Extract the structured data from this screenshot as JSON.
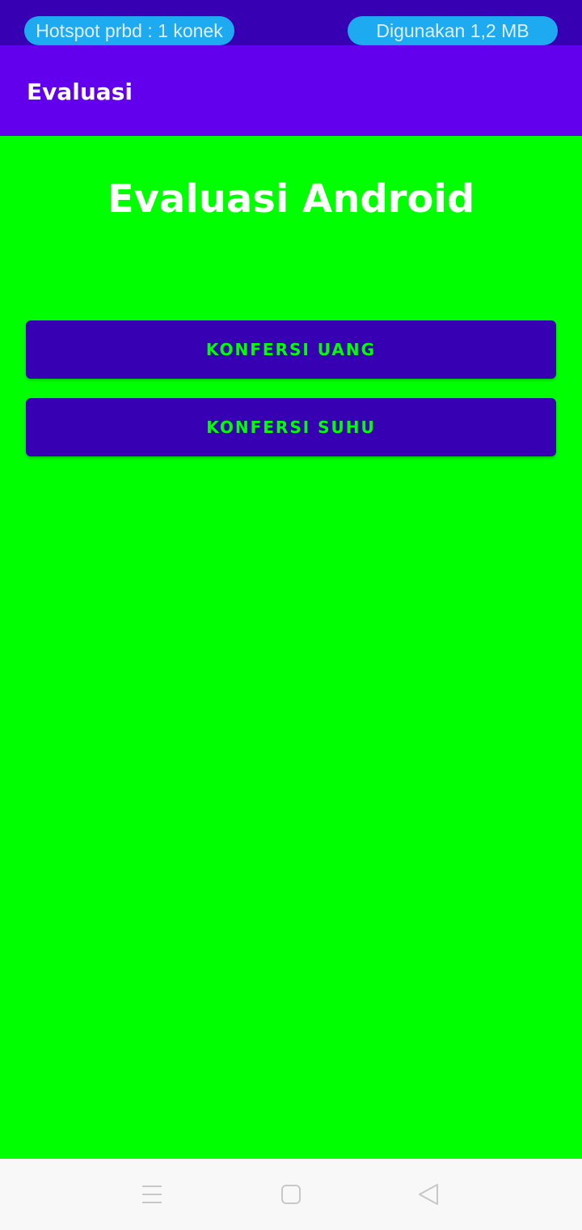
{
  "status_bar": {
    "hotspot": "Hotspot prbd : 1 konek",
    "usage": "Digunakan 1,2 MB"
  },
  "app_bar": {
    "title": "Evaluasi"
  },
  "main": {
    "heading": "Evaluasi Android",
    "buttons": [
      {
        "label": "KONFERSI UANG"
      },
      {
        "label": "KONFERSI SUHU"
      }
    ]
  },
  "nav_bar": {
    "icons": [
      "menu-icon",
      "home-icon",
      "back-icon"
    ]
  },
  "colors": {
    "status_bar": "#3700b3",
    "app_bar": "#6200ee",
    "background": "#00ff00",
    "button": "#3700b3",
    "button_text": "#00ff00",
    "pill": "#1eaaf0"
  }
}
